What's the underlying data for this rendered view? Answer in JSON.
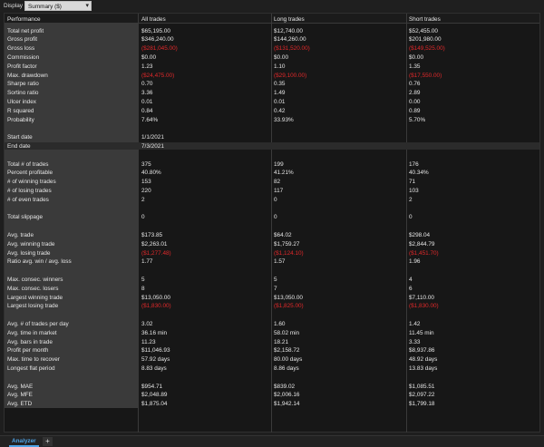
{
  "toolbar": {
    "display_label": "Display",
    "display_value": "Summary ($)"
  },
  "header": {
    "col0": "Performance",
    "col1": "All trades",
    "col2": "Long trades",
    "col3": "Short trades"
  },
  "rows": [
    {
      "label": "Total net profit",
      "all": "$65,195.00",
      "long": "$12,740.00",
      "short": "$52,455.00"
    },
    {
      "label": "Gross profit",
      "all": "$346,240.00",
      "long": "$144,260.00",
      "short": "$201,980.00"
    },
    {
      "label": "Gross loss",
      "all": "($281,045.00)",
      "long": "($131,520.00)",
      "short": "($149,525.00)",
      "neg": true
    },
    {
      "label": "Commission",
      "all": "$0.00",
      "long": "$0.00",
      "short": "$0.00"
    },
    {
      "label": "Profit factor",
      "all": "1.23",
      "long": "1.10",
      "short": "1.35"
    },
    {
      "label": "Max. drawdown",
      "all": "($24,475.00)",
      "long": "($29,100.00)",
      "short": "($17,550.00)",
      "neg": true
    },
    {
      "label": "Sharpe ratio",
      "all": "0.70",
      "long": "0.35",
      "short": "0.76"
    },
    {
      "label": "Sortino ratio",
      "all": "3.36",
      "long": "1.49",
      "short": "2.89"
    },
    {
      "label": "Ulcer index",
      "all": "0.01",
      "long": "0.01",
      "short": "0.00"
    },
    {
      "label": "R squared",
      "all": "0.84",
      "long": "0.42",
      "short": "0.89"
    },
    {
      "label": "Probability",
      "all": "7.64%",
      "long": "33.93%",
      "short": "5.70%"
    },
    {
      "label": "",
      "all": "",
      "long": "",
      "short": ""
    },
    {
      "label": "Start date",
      "all": "1/1/2021",
      "long": "",
      "short": ""
    },
    {
      "label": "End date",
      "all": "7/3/2021",
      "long": "",
      "short": "",
      "hl": true
    },
    {
      "label": "",
      "all": "",
      "long": "",
      "short": ""
    },
    {
      "label": "Total # of trades",
      "all": "375",
      "long": "199",
      "short": "176"
    },
    {
      "label": "Percent profitable",
      "all": "40.80%",
      "long": "41.21%",
      "short": "40.34%"
    },
    {
      "label": "# of winning trades",
      "all": "153",
      "long": "82",
      "short": "71"
    },
    {
      "label": "# of losing trades",
      "all": "220",
      "long": "117",
      "short": "103"
    },
    {
      "label": "# of even trades",
      "all": "2",
      "long": "0",
      "short": "2"
    },
    {
      "label": "",
      "all": "",
      "long": "",
      "short": ""
    },
    {
      "label": "Total slippage",
      "all": "0",
      "long": "0",
      "short": "0"
    },
    {
      "label": "",
      "all": "",
      "long": "",
      "short": ""
    },
    {
      "label": "Avg. trade",
      "all": "$173.85",
      "long": "$64.02",
      "short": "$298.04"
    },
    {
      "label": "Avg. winning trade",
      "all": "$2,263.01",
      "long": "$1,759.27",
      "short": "$2,844.79"
    },
    {
      "label": "Avg. losing trade",
      "all": "($1,277.48)",
      "long": "($1,124.10)",
      "short": "($1,451.70)",
      "neg": true
    },
    {
      "label": "Ratio avg. win / avg. loss",
      "all": "1.77",
      "long": "1.57",
      "short": "1.96"
    },
    {
      "label": "",
      "all": "",
      "long": "",
      "short": ""
    },
    {
      "label": "Max. consec. winners",
      "all": "5",
      "long": "5",
      "short": "4"
    },
    {
      "label": "Max. consec. losers",
      "all": "8",
      "long": "7",
      "short": "6"
    },
    {
      "label": "Largest winning trade",
      "all": "$13,050.00",
      "long": "$13,050.00",
      "short": "$7,110.00"
    },
    {
      "label": "Largest losing trade",
      "all": "($1,830.00)",
      "long": "($1,825.00)",
      "short": "($1,830.00)",
      "neg": true
    },
    {
      "label": "",
      "all": "",
      "long": "",
      "short": ""
    },
    {
      "label": "Avg. # of trades per day",
      "all": "3.02",
      "long": "1.60",
      "short": "1.42"
    },
    {
      "label": "Avg. time in market",
      "all": "36.16 min",
      "long": "58.02 min",
      "short": "11.45 min"
    },
    {
      "label": "Avg. bars in trade",
      "all": "11.23",
      "long": "18.21",
      "short": "3.33"
    },
    {
      "label": "Profit per month",
      "all": "$11,046.93",
      "long": "$2,158.72",
      "short": "$8,937.86"
    },
    {
      "label": "Max. time to recover",
      "all": "57.92 days",
      "long": "80.00 days",
      "short": "48.92 days"
    },
    {
      "label": "Longest flat period",
      "all": "8.83 days",
      "long": "8.86 days",
      "short": "13.83 days"
    },
    {
      "label": "",
      "all": "",
      "long": "",
      "short": ""
    },
    {
      "label": "Avg. MAE",
      "all": "$954.71",
      "long": "$839.02",
      "short": "$1,085.51"
    },
    {
      "label": "Avg. MFE",
      "all": "$2,048.89",
      "long": "$2,006.16",
      "short": "$2,097.22"
    },
    {
      "label": "Avg. ETD",
      "all": "$1,875.04",
      "long": "$1,942.14",
      "short": "$1,799.18"
    }
  ],
  "tabs": {
    "active": "Analyzer",
    "add": "+"
  }
}
